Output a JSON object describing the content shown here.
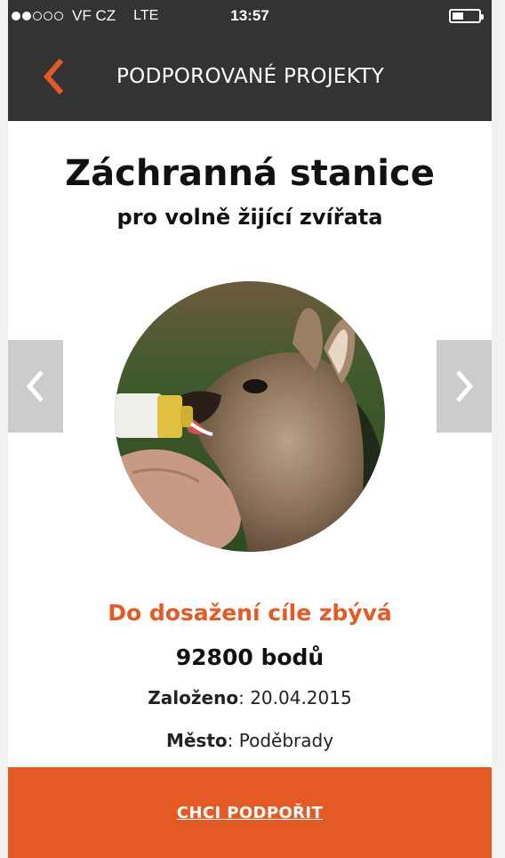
{
  "status_bar": {
    "signal_filled": 2,
    "signal_total": 5,
    "carrier": "VF CZ",
    "network": "LTE",
    "time": "13:57",
    "battery_level": 0.3
  },
  "nav": {
    "back_icon": "chevron-left-icon",
    "title": "PODPOROVANÉ PROJEKTY"
  },
  "project": {
    "title": "Záchranná stanice",
    "subtitle": "pro volně žijící zvířata",
    "image_alt_icon": "fawn-photo",
    "goal_label": "Do dosažení cíle zbývá",
    "goal_value": "92800 bodů",
    "founded_label": "Založeno",
    "founded_value": "20.04.2015",
    "city_label": "Město",
    "city_value": "Poděbrady"
  },
  "carousel": {
    "prev_icon": "chevron-left-icon",
    "next_icon": "chevron-right-icon"
  },
  "cta": {
    "label": "CHCI PODPOŘIT"
  },
  "colors": {
    "accent": "#e35a24",
    "header": "#333333",
    "arrow_bg": "#cccccc"
  }
}
